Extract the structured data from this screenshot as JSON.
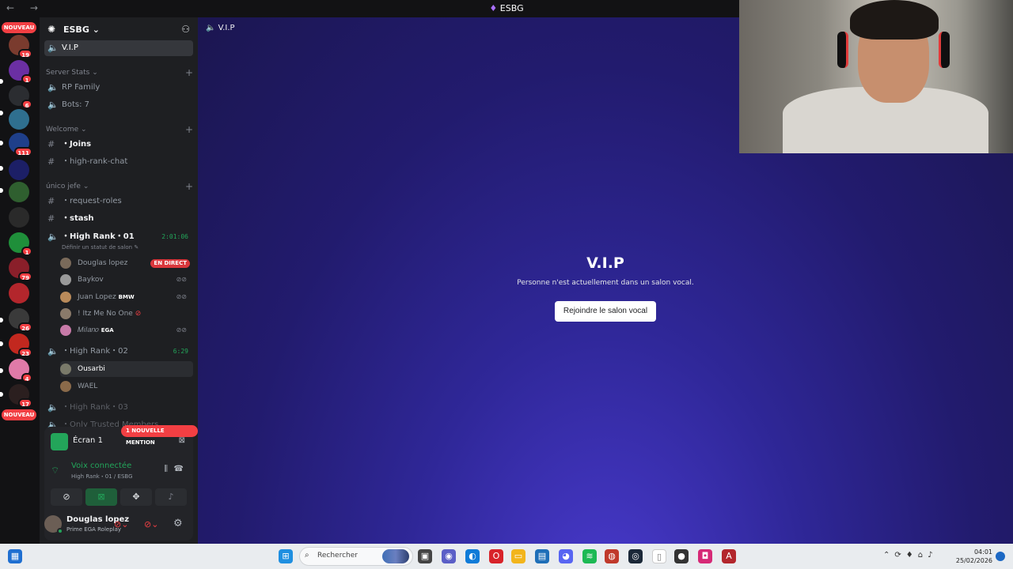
{
  "window": {
    "title": "ESBG",
    "nav": "← →"
  },
  "rail": {
    "badges": [
      "NOUVEAU",
      "19",
      "1",
      "6",
      "111",
      "1",
      "79",
      "26",
      "23",
      "4",
      "17",
      "NOUVEAU"
    ]
  },
  "server": {
    "name": "ESBG"
  },
  "current_channel": {
    "name": "V.I.P"
  },
  "categories": {
    "server_stats": "Server Stats",
    "welcome": "Welcome",
    "unico": "único jefe"
  },
  "channels": {
    "rp_family": "RP Family",
    "bots": "Bots: 7",
    "joins": "・Joins",
    "high_rank_chat": "・high-rank-chat",
    "request_roles": "・request-roles",
    "stash": "・stash",
    "high_rank_01": "・High Rank・01",
    "high_rank_01_timer": "2:01:06",
    "status_hint": "Définir un statut de salon",
    "high_rank_02": "・High Rank・02",
    "high_rank_02_timer": "6:29",
    "high_rank_03": "・High Rank・03",
    "only_trusted": "・Only Trusted Members"
  },
  "voice_users": {
    "u1": "Douglas lopez",
    "u1_live": "EN DIRECT",
    "u2": "Baykov",
    "u3": "Juan Lopez",
    "u3_tag": "BMW",
    "u4": "! Itz Me No One",
    "u5": "𝑀𝑖𝑙𝑎𝑛𝑜",
    "u5_tag": "EGA",
    "u6": "Ousarbi",
    "u7": "WAEL"
  },
  "mention_banner": "1 NOUVELLE MENTION",
  "panel": {
    "screen_title": "Écran 1",
    "voice_connected": "Voix connectée",
    "voice_sub": "High Rank・01 / ESBG",
    "user_name": "Douglas lopez",
    "user_status": "Prime EGA Roleplay"
  },
  "main": {
    "header": "V.I.P",
    "title": "V.I.P",
    "subtitle": "Personne n'est actuellement dans un salon vocal.",
    "join_button": "Rejoindre le salon vocal"
  },
  "taskbar": {
    "search_placeholder": "Rechercher",
    "time": "04:01",
    "date": "25/02/2026"
  },
  "colors": {
    "accent_green": "#23a55a",
    "danger": "#f23f43",
    "background_main": "#2f2798"
  }
}
